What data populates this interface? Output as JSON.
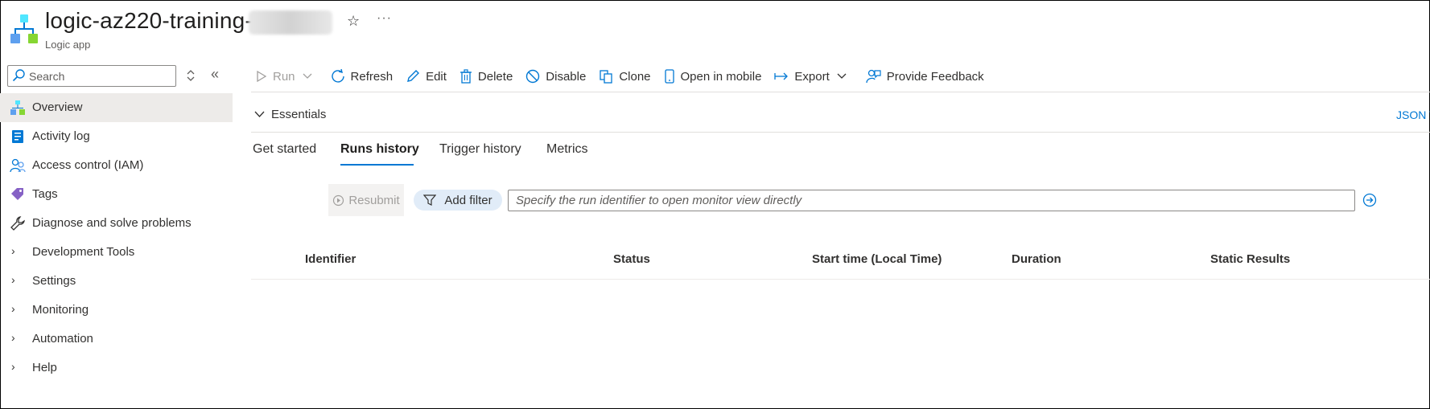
{
  "header": {
    "title": "logic-az220-training-",
    "subtitle": "Logic app",
    "favorite_icon": "star-icon",
    "more_icon": "ellipsis-icon"
  },
  "sidebar": {
    "search_placeholder": "Search",
    "items": [
      {
        "label": "Overview",
        "icon": "logic-app-icon",
        "active": true
      },
      {
        "label": "Activity log",
        "icon": "activity-log-icon"
      },
      {
        "label": "Access control (IAM)",
        "icon": "people-icon"
      },
      {
        "label": "Tags",
        "icon": "tag-icon"
      },
      {
        "label": "Diagnose and solve problems",
        "icon": "wrench-icon"
      },
      {
        "label": "Development Tools",
        "icon": "chevron-right-icon"
      },
      {
        "label": "Settings",
        "icon": "chevron-right-icon"
      },
      {
        "label": "Monitoring",
        "icon": "chevron-right-icon"
      },
      {
        "label": "Automation",
        "icon": "chevron-right-icon"
      },
      {
        "label": "Help",
        "icon": "chevron-right-icon"
      }
    ]
  },
  "toolbar": {
    "run": "Run",
    "refresh": "Refresh",
    "edit": "Edit",
    "delete": "Delete",
    "disable": "Disable",
    "clone": "Clone",
    "open_mobile": "Open in mobile",
    "export": "Export",
    "feedback": "Provide Feedback"
  },
  "essentials": {
    "label": "Essentials",
    "json_link": "JSON V"
  },
  "tabs": [
    {
      "label": "Get started"
    },
    {
      "label": "Runs history",
      "active": true
    },
    {
      "label": "Trigger history"
    },
    {
      "label": "Metrics"
    }
  ],
  "runs": {
    "resubmit": "Resubmit",
    "add_filter": "Add filter",
    "identifier_placeholder": "Specify the run identifier to open monitor view directly",
    "columns": [
      "Identifier",
      "Status",
      "Start time (Local Time)",
      "Duration",
      "Static Results"
    ]
  },
  "colors": {
    "accent": "#0078d4",
    "nav_active_bg": "#edebe9",
    "filter_pill_bg": "#e1ecf8"
  }
}
